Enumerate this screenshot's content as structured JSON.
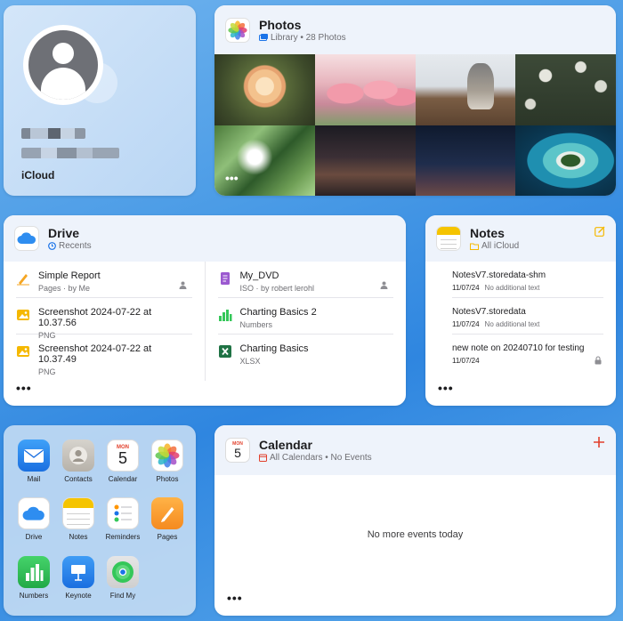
{
  "profile": {
    "account_label": "iCloud"
  },
  "photos": {
    "title": "Photos",
    "subtitle": "Library • 28 Photos",
    "more_label": "•••"
  },
  "drive": {
    "title": "Drive",
    "subtitle": "Recents",
    "more_label": "•••",
    "left_files": [
      {
        "name": "Simple Report",
        "meta": "Pages · by Me"
      },
      {
        "name": "Screenshot 2024-07-22 at 10.37.56",
        "meta": "PNG"
      },
      {
        "name": "Screenshot 2024-07-22 at 10.37.49",
        "meta": "PNG"
      }
    ],
    "right_files": [
      {
        "name": "My_DVD",
        "meta": "ISO · by robert lerohl"
      },
      {
        "name": "Charting Basics 2",
        "meta": "Numbers"
      },
      {
        "name": "Charting Basics",
        "meta": "XLSX"
      }
    ]
  },
  "notes": {
    "title": "Notes",
    "subtitle": "All iCloud",
    "more_label": "•••",
    "items": [
      {
        "title": "NotesV7.storedata-shm",
        "date": "11/07/24",
        "preview": "No additional text"
      },
      {
        "title": "NotesV7.storedata",
        "date": "11/07/24",
        "preview": "No additional text"
      },
      {
        "title": "new note on 20240710 for testing",
        "date": "11/07/24",
        "preview": ""
      }
    ]
  },
  "apps": [
    {
      "label": "Mail",
      "icon": "mail-icon"
    },
    {
      "label": "Contacts",
      "icon": "contacts-icon"
    },
    {
      "label": "Calendar",
      "icon": "calendar-icon"
    },
    {
      "label": "Photos",
      "icon": "photos-icon"
    },
    {
      "label": "Drive",
      "icon": "drive-icon"
    },
    {
      "label": "Notes",
      "icon": "notes-icon"
    },
    {
      "label": "Reminders",
      "icon": "reminders-icon"
    },
    {
      "label": "Pages",
      "icon": "pages-icon"
    },
    {
      "label": "Numbers",
      "icon": "numbers-icon"
    },
    {
      "label": "Keynote",
      "icon": "keynote-icon"
    },
    {
      "label": "Find My",
      "icon": "find-my-icon"
    }
  ],
  "calendar": {
    "title": "Calendar",
    "subtitle": "All Calendars • No Events",
    "icon_month": "MON",
    "icon_day": "5",
    "empty_text": "No more events today",
    "more_label": "•••"
  },
  "colors": {
    "accent_blue": "#1a73e8",
    "notes_yellow": "#f5b800",
    "calendar_red": "#e2402c"
  }
}
